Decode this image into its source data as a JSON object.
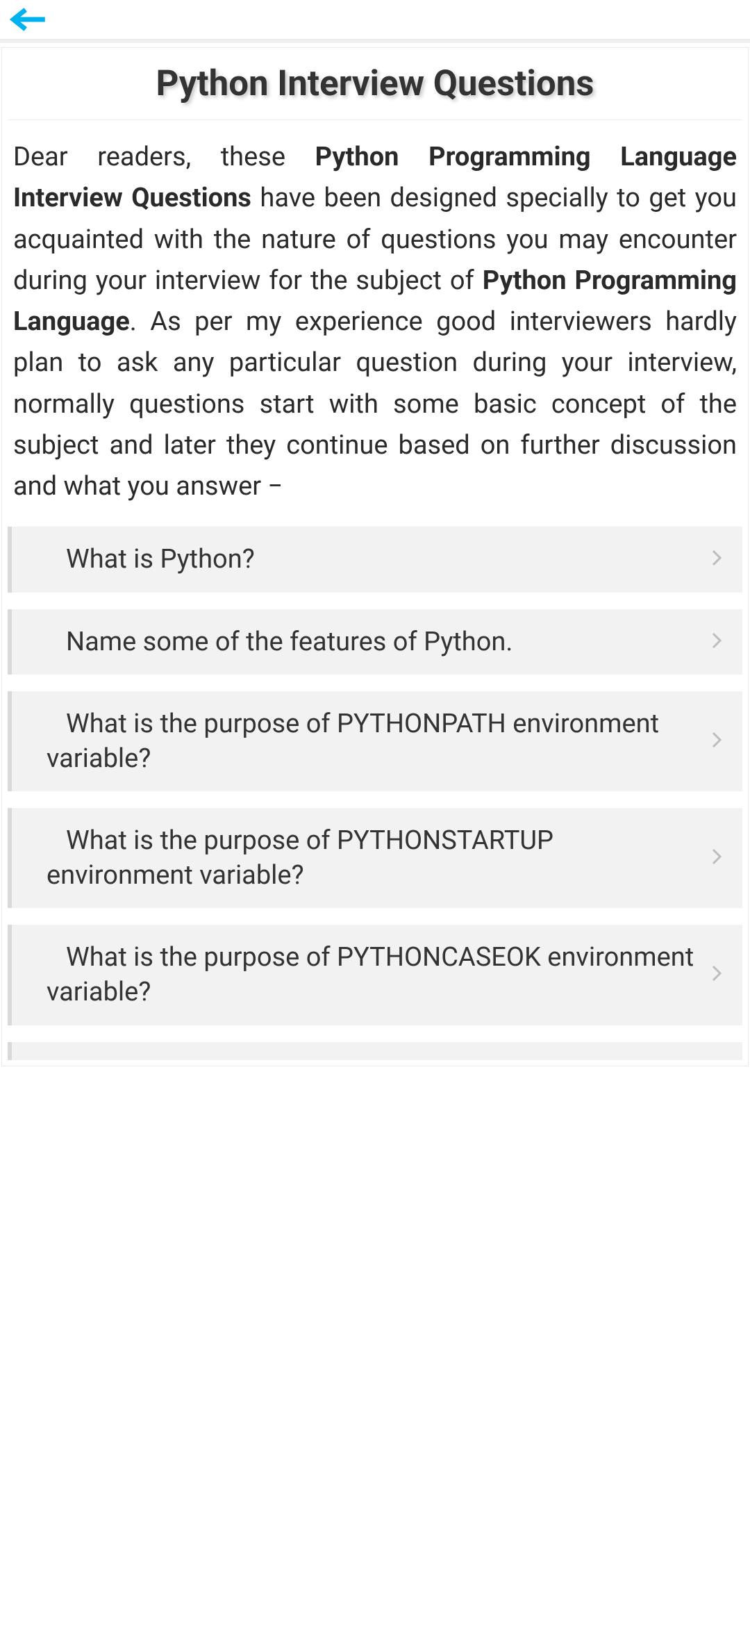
{
  "nav": {
    "back_icon": "arrow-left"
  },
  "page": {
    "title": "Python Interview Questions"
  },
  "intro": {
    "lead": "Dear readers, these ",
    "bold1": "Python Programming Language Interview Questions",
    "mid1": " have been designed specially to get you acquainted with the nature of questions you may encounter during your interview for the subject of ",
    "bold2": "Python Programming Language",
    "tail": ". As per my experience good interviewers hardly plan to ask any particular question during your interview, normally questions start with some basic concept of the subject and later they continue based on further discussion and what you answer −"
  },
  "questions": [
    {
      "text": "What is Python?"
    },
    {
      "text": "Name some of the features of Python."
    },
    {
      "text": "What is the purpose of PYTHONPATH environment variable?"
    },
    {
      "text": "What is the purpose of PYTHONSTARTUP environment variable?"
    },
    {
      "text": "What is the purpose of PYTHONCASEOK environment variable?"
    }
  ],
  "colors": {
    "accent": "#00B3F0",
    "panel_bg": "#f2f2f2",
    "panel_border": "#d9d9d9"
  }
}
